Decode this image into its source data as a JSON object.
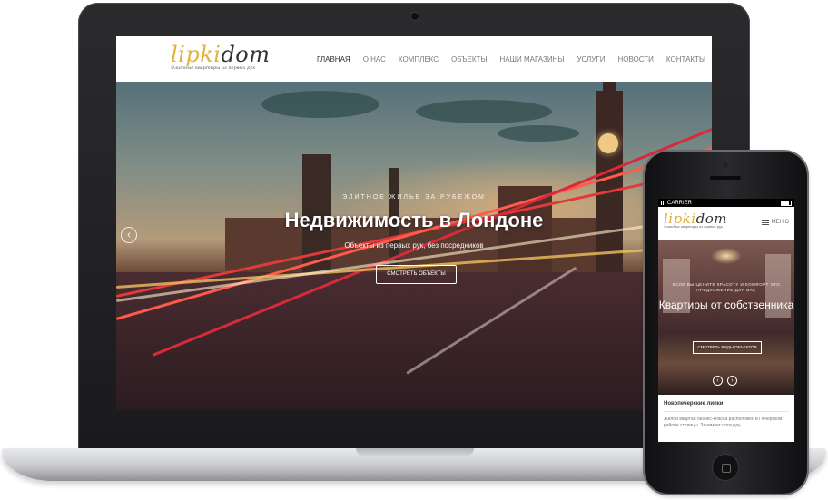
{
  "desktop": {
    "logo": {
      "part1": "lipki",
      "part2": "dom",
      "tagline": "Элитные квартиры из первых рук"
    },
    "nav": [
      {
        "label": "ГЛАВНАЯ"
      },
      {
        "label": "О НАС"
      },
      {
        "label": "КОМПЛЕКС"
      },
      {
        "label": "ОБЪЕКТЫ"
      },
      {
        "label": "НАШИ МАГАЗИНЫ"
      },
      {
        "label": "УСЛУГИ"
      },
      {
        "label": "НОВОСТИ"
      },
      {
        "label": "КОНТАКТЫ"
      }
    ],
    "hero": {
      "subtitle": "ЭЛИТНОЕ ЖИЛЬЕ ЗА РУБЕЖОМ",
      "title": "Недвижимость в Лондоне",
      "description": "Объекты из первых рук, без посредников",
      "button": "СМОТРЕТЬ ОБЪЕКТЫ",
      "prev_arrow": "‹"
    }
  },
  "mobile": {
    "status": {
      "carrier": "CARRIER"
    },
    "logo": {
      "part1": "lipki",
      "part2": "dom",
      "tagline": "Элитные квартиры из первых рук"
    },
    "menu_label": "МЕНЮ",
    "hero": {
      "subtitle": "ЕСЛИ ВЫ ЦЕНИТЕ КРАСОТУ И КОМФОРТ ЭТО ПРЕДЛОЖЕНИЕ ДЛЯ ВАС",
      "title": "Квартиры от собственника",
      "button": "СМОТРЕТЬ ВИДЫ ОБЪЕКТОВ",
      "prev_arrow": "‹",
      "next_arrow": "›"
    },
    "section": {
      "title": "Новопечерские липки",
      "text": "Жилой квартал бизнес-класса расположен в Печерском районе столицы. Занимает площадь"
    }
  },
  "colors": {
    "logo_accent": "#e2b23a",
    "logo_dark": "#333333"
  }
}
